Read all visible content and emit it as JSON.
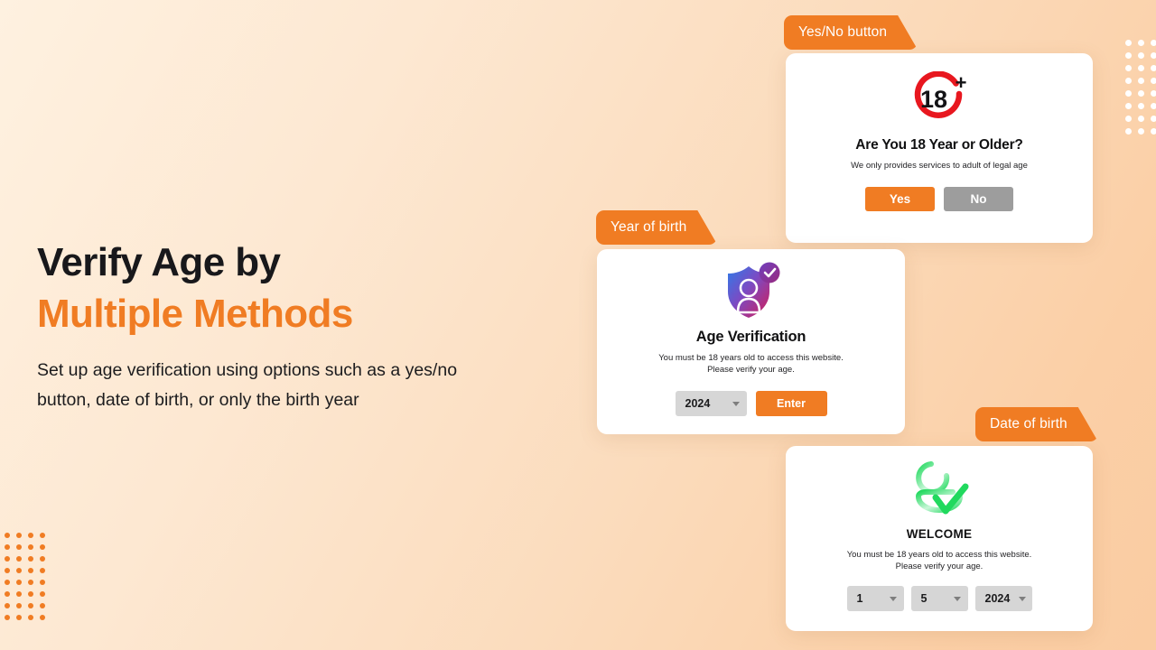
{
  "theme": {
    "accent": "#F07C23",
    "bg_start": "#FEF1E0",
    "bg_end": "#FACCA2",
    "grey_button": "#9D9D9D",
    "select_grey": "#D6D6D6",
    "badge_red": "#E8171F",
    "green": "#2BE06A"
  },
  "hero": {
    "title_line1": "Verify Age by",
    "title_line2": "Multiple Methods",
    "description": "Set up age verification using options such as a yes/no button, date of birth, or only the birth year"
  },
  "tags": {
    "yes_no": "Yes/No button",
    "year_of_birth": "Year of birth",
    "date_of_birth": "Date of birth"
  },
  "cards": {
    "yes_no": {
      "icon": "eighteen-plus-icon",
      "badge_number": "18",
      "badge_plus": "+",
      "title": "Are You 18 Year or Older?",
      "subtitle": "We only provides services to adult of legal age",
      "yes_label": "Yes",
      "no_label": "No"
    },
    "year_of_birth": {
      "icon": "shield-person-check-icon",
      "title": "Age Verification",
      "subtitle_line1": "You must be 18 years old to access this website.",
      "subtitle_line2": "Please verify your age.",
      "year_value": "2024",
      "enter_label": "Enter"
    },
    "date_of_birth": {
      "icon": "person-check-green-icon",
      "title": "WELCOME",
      "subtitle_line1": "You must be 18 years old to access this website.",
      "subtitle_line2": "Please verify your age.",
      "day_value": "1",
      "month_value": "5",
      "year_value": "2024"
    }
  },
  "decor": {
    "dots_top_right_rows": 8,
    "dots_top_right_cols": 4,
    "dots_bottom_left_rows": 8,
    "dots_bottom_left_cols": 4
  }
}
